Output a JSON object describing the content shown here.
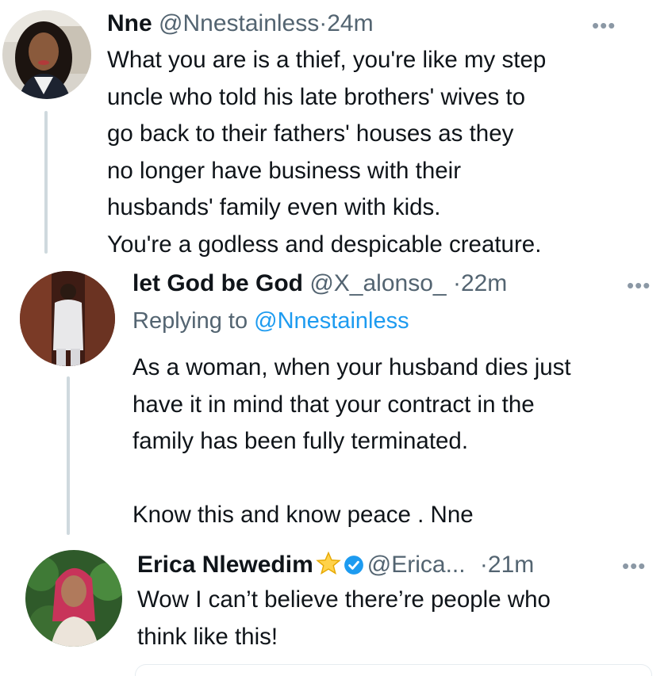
{
  "tweets": [
    {
      "name": "Nne",
      "handle": "@Nnestainless",
      "separator": "·",
      "time": "24m",
      "more": "•••",
      "lines": [
        "What you are is a thief, you're like my step",
        "uncle who told his late brothers' wives to",
        "go back to their fathers' houses as they",
        "no longer have business with their",
        "husbands' family even with kids.",
        "You're a godless and despicable creature."
      ]
    },
    {
      "name": "let God be God",
      "handle": "@X_alonso_",
      "separator": "·",
      "time": "22m",
      "more": "•••",
      "replying_prefix": "Replying to ",
      "replying_to": "@Nnestainless",
      "lines": [
        "As a woman, when your husband dies just",
        "have it in mind that your contract in the",
        "family has been fully terminated.",
        "",
        "Know this and know peace . Nne"
      ]
    },
    {
      "name": "Erica Nlewedim",
      "handle": "@Erica...",
      "separator": "·",
      "time": "21m",
      "more": "•••",
      "verified_icon": "verified-badge-icon",
      "star_icon": "star-icon",
      "lines": [
        "Wow I can’t believe there’re people who",
        "think like this!"
      ]
    }
  ],
  "colors": {
    "text": "#0f1419",
    "secondary": "#536471",
    "link": "#1d9bf0",
    "thread_line": "#cfd9de"
  }
}
